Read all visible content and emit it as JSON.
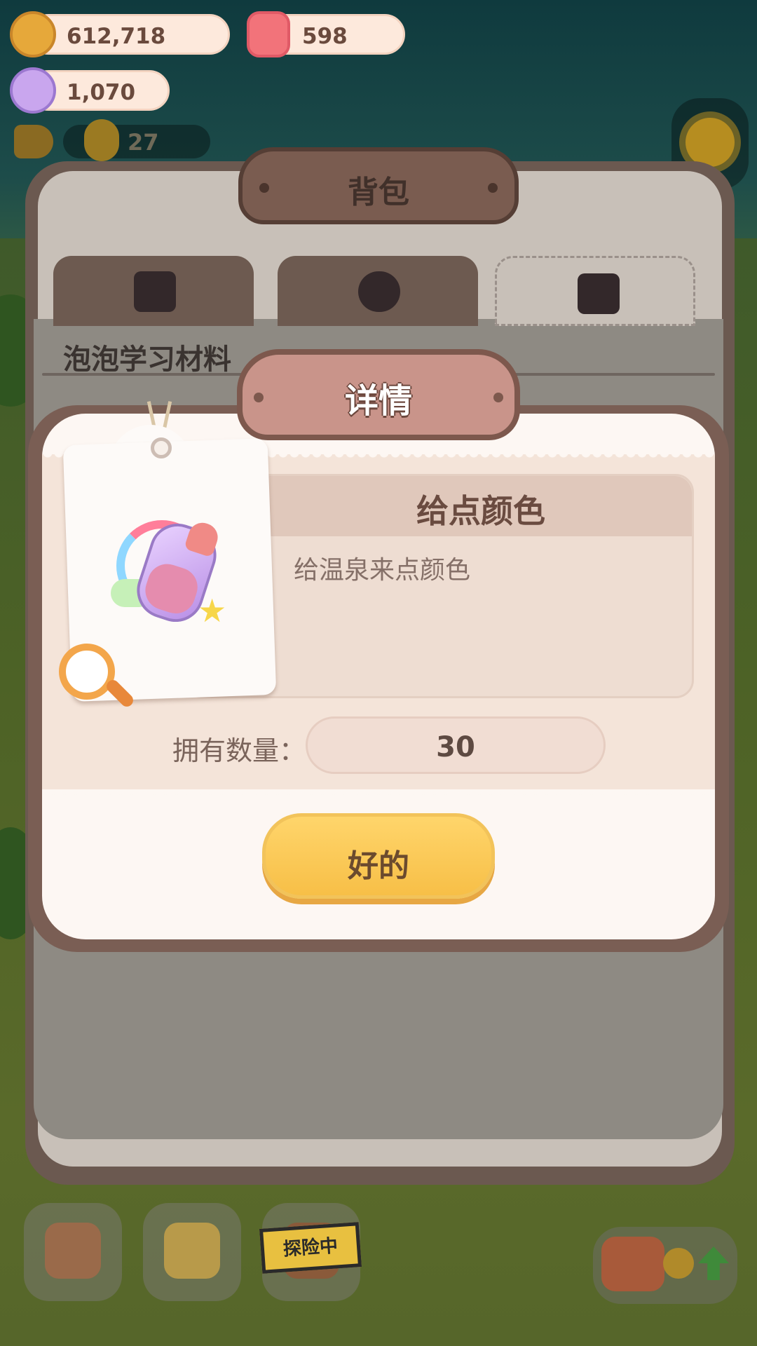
{
  "hud": {
    "coins": "612,718",
    "gems": "598",
    "candy": "1,070",
    "helpers": "27"
  },
  "backpack": {
    "title": "背包",
    "tabs": [
      {
        "icon": "box-icon",
        "active": false
      },
      {
        "icon": "chef-icon",
        "active": false
      },
      {
        "icon": "bottle-heart-icon",
        "active": true
      }
    ],
    "section": "泡泡学习材料"
  },
  "dock": {
    "explore_label": "探险中"
  },
  "dialog": {
    "title": "详情",
    "item_name": "给点颜色",
    "item_desc": "给温泉来点颜色",
    "quantity_label": "拥有数量：",
    "quantity": "30",
    "ok_label": "好的"
  },
  "colors": {
    "dialog_bg": "#fdf7f3",
    "title_plate": "#c9948a",
    "ok_button": "#f7bf47"
  }
}
